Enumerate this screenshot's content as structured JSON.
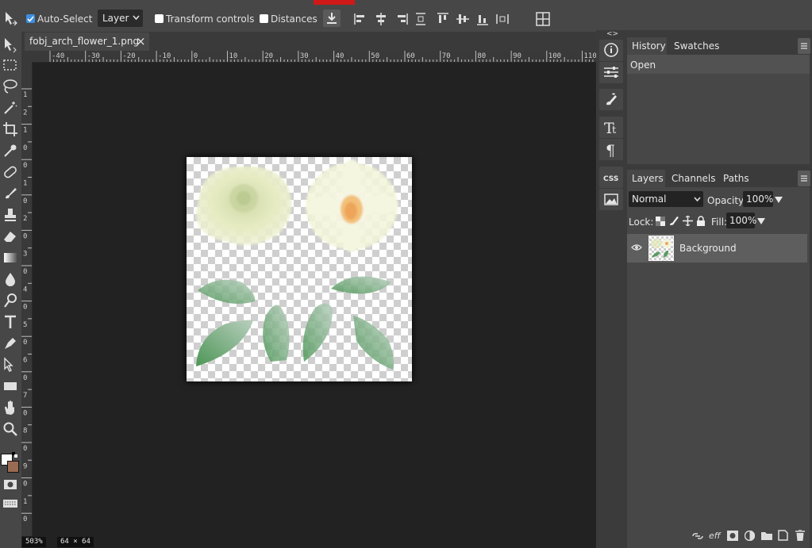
{
  "options_bar": {
    "auto_select_label": "Auto-Select",
    "auto_select_checked": true,
    "target_select_value": "Layer",
    "transform_controls_label": "Transform controls",
    "transform_controls_checked": false,
    "distances_label": "Distances",
    "distances_checked": false
  },
  "document": {
    "tab_title": "fobj_arch_flower_1.png",
    "close_symbol": "×"
  },
  "ruler": {
    "horizontal": [
      "-40",
      "-30",
      "-20",
      "-10",
      "0",
      "10",
      "20",
      "30",
      "40",
      "50",
      "60",
      "70",
      "80",
      "90",
      "100",
      "110"
    ],
    "vertical": [
      "1",
      "2",
      "1",
      "0",
      "0",
      "1",
      "0",
      "2",
      "0",
      "3",
      "0",
      "4",
      "0",
      "5",
      "0",
      "6",
      "0",
      "7",
      "0",
      "8",
      "0",
      "9",
      "0",
      "1",
      "0"
    ]
  },
  "status": {
    "zoom": "503%",
    "dimensions": "64 × 64"
  },
  "side_strip": {
    "expand_left": "<>",
    "expand_right": "><"
  },
  "history_panel": {
    "tabs": [
      "History",
      "Swatches"
    ],
    "items": [
      "Open"
    ]
  },
  "layers_panel": {
    "tabs": [
      "Layers",
      "Channels",
      "Paths"
    ],
    "blend_mode": "Normal",
    "opacity_label": "Opacity:",
    "opacity_value": "100%",
    "lock_label": "Lock:",
    "fill_label": "Fill:",
    "fill_value": "100%",
    "layers": [
      {
        "name": "Background",
        "visible": true
      }
    ],
    "footer_effects_label": "eff"
  },
  "icons": {
    "tool_icons": [
      "move-tool-icon",
      "marquee-tool-icon",
      "lasso-tool-icon",
      "magic-wand-icon",
      "crop-tool-icon",
      "eyedropper-icon",
      "healing-brush-icon",
      "brush-tool-icon",
      "clone-stamp-icon",
      "eraser-icon",
      "gradient-icon",
      "blur-drop-icon",
      "dodge-icon",
      "type-tool-icon",
      "pen-tool-icon",
      "path-select-icon",
      "rectangle-tool-icon",
      "hand-tool-icon",
      "zoom-tool-icon"
    ],
    "info": "info-icon",
    "adjust": "sliders-icon"
  },
  "colors": {
    "foreground": "#ffffff",
    "background": "#9a6b53",
    "accent": "#3d8fe0"
  }
}
